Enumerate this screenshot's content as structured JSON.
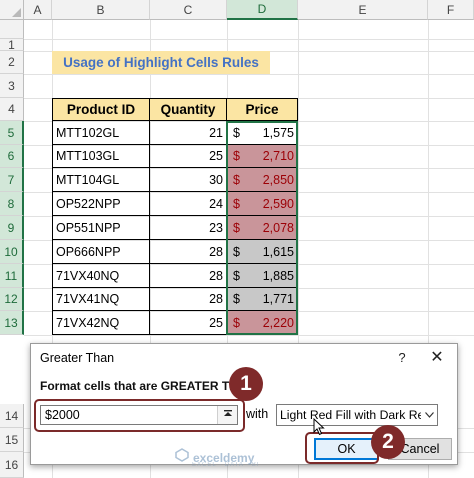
{
  "columns": [
    "A",
    "B",
    "C",
    "D",
    "E",
    "F"
  ],
  "selected_column": "D",
  "rows": [
    "1",
    "2",
    "3",
    "4",
    "5",
    "6",
    "7",
    "8",
    "9",
    "10",
    "11",
    "12",
    "13",
    "14",
    "15",
    "16"
  ],
  "title": "Usage of Highlight Cells Rules",
  "table": {
    "headers": [
      "Product ID",
      "Quantity",
      "Price"
    ],
    "currency_symbol": "$",
    "rows": [
      {
        "id": "MTT102GL",
        "qty": "21",
        "price": "1,575",
        "highlight": "none"
      },
      {
        "id": "MTT103GL",
        "qty": "25",
        "price": "2,710",
        "highlight": "red"
      },
      {
        "id": "MTT104GL",
        "qty": "30",
        "price": "2,850",
        "highlight": "red"
      },
      {
        "id": "OP522NPP",
        "qty": "24",
        "price": "2,590",
        "highlight": "red"
      },
      {
        "id": "OP551NPP",
        "qty": "23",
        "price": "2,078",
        "highlight": "red"
      },
      {
        "id": "OP666NPP",
        "qty": "28",
        "price": "1,615",
        "highlight": "gray"
      },
      {
        "id": "71VX40NQ",
        "qty": "28",
        "price": "1,885",
        "highlight": "gray"
      },
      {
        "id": "71VX41NQ",
        "qty": "28",
        "price": "1,771",
        "highlight": "gray"
      },
      {
        "id": "71VX42NQ",
        "qty": "25",
        "price": "2,220",
        "highlight": "red"
      }
    ]
  },
  "dialog": {
    "title": "Greater Than",
    "help": "?",
    "close": "✕",
    "label": "Format cells that are GREATER THAN:",
    "value": "$2000",
    "with_label": "with",
    "format_option": "Light Red Fill with Dark Red Text",
    "ok_label": "OK",
    "cancel_label": "Cancel"
  },
  "callouts": {
    "step1": "1",
    "step2": "2"
  },
  "watermark": {
    "name": "exceldemy",
    "tagline": "EXCEL · DATA · BI"
  },
  "colors": {
    "red_fill": "#c9959a",
    "red_text": "#9c0006",
    "header_fill": "#fbe5a3",
    "title_text": "#4472c4",
    "callout": "#7f2a2a",
    "accent": "#217346"
  }
}
